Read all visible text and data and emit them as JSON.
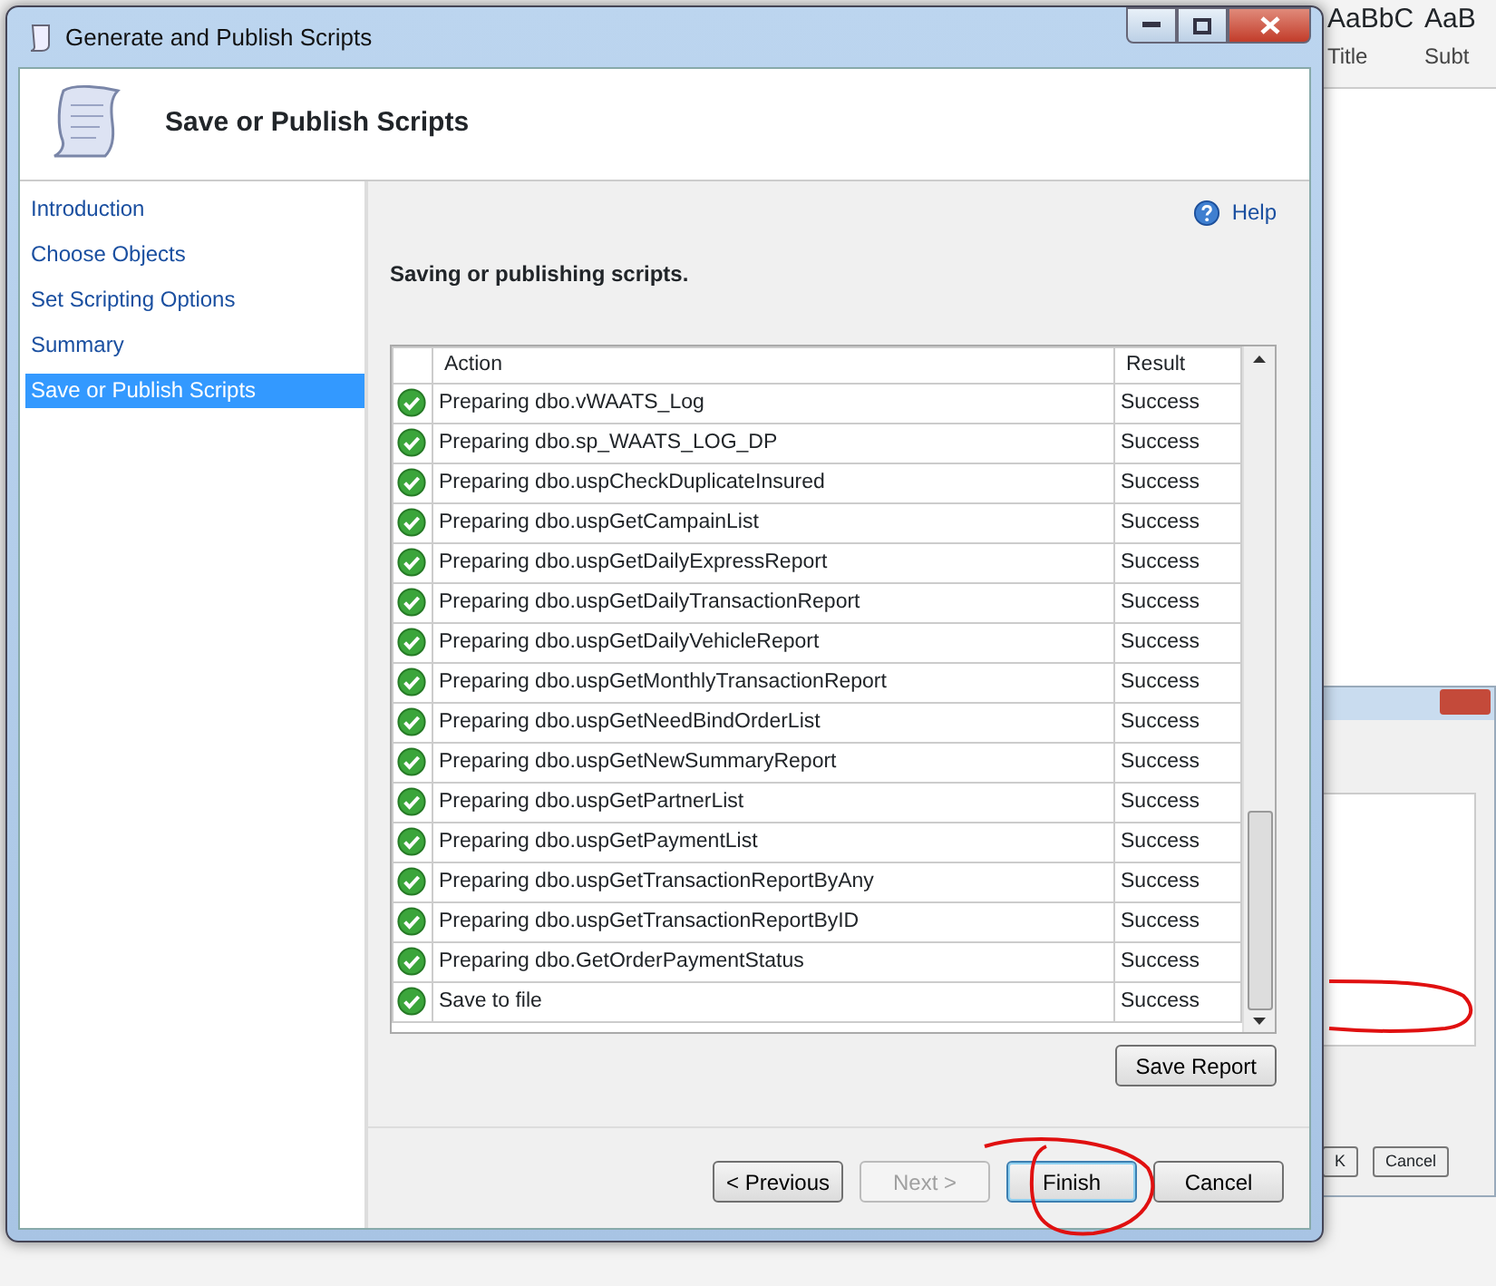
{
  "window": {
    "title": "Generate and Publish Scripts"
  },
  "header": {
    "title": "Save or Publish Scripts"
  },
  "nav": [
    {
      "label": "Introduction",
      "selected": false
    },
    {
      "label": "Choose Objects",
      "selected": false
    },
    {
      "label": "Set Scripting Options",
      "selected": false
    },
    {
      "label": "Summary",
      "selected": false
    },
    {
      "label": "Save or Publish Scripts",
      "selected": true
    }
  ],
  "help": "Help",
  "heading": "Saving or publishing scripts.",
  "table": {
    "columns": [
      "Action",
      "Result"
    ],
    "rows": [
      {
        "kind": "success",
        "action": "Preparing dbo.vWAATS_Log",
        "result": "Success"
      },
      {
        "kind": "success",
        "action": "Preparing dbo.sp_WAATS_LOG_DP",
        "result": "Success"
      },
      {
        "kind": "success",
        "action": "Preparing dbo.uspCheckDuplicateInsured",
        "result": "Success"
      },
      {
        "kind": "success",
        "action": "Preparing dbo.uspGetCampainList",
        "result": "Success"
      },
      {
        "kind": "success",
        "action": "Preparing dbo.uspGetDailyExpressReport",
        "result": "Success"
      },
      {
        "kind": "success",
        "action": "Preparing dbo.uspGetDailyTransactionReport",
        "result": "Success"
      },
      {
        "kind": "success",
        "action": "Preparing dbo.uspGetDailyVehicleReport",
        "result": "Success"
      },
      {
        "kind": "success",
        "action": "Preparing dbo.uspGetMonthlyTransactionReport",
        "result": "Success"
      },
      {
        "kind": "success",
        "action": "Preparing dbo.uspGetNeedBindOrderList",
        "result": "Success"
      },
      {
        "kind": "success",
        "action": "Preparing dbo.uspGetNewSummaryReport",
        "result": "Success"
      },
      {
        "kind": "success",
        "action": "Preparing dbo.uspGetPartnerList",
        "result": "Success"
      },
      {
        "kind": "success",
        "action": "Preparing dbo.uspGetPaymentList",
        "result": "Success"
      },
      {
        "kind": "success",
        "action": "Preparing dbo.uspGetTransactionReportByAny",
        "result": "Success"
      },
      {
        "kind": "success",
        "action": "Preparing dbo.uspGetTransactionReportByID",
        "result": "Success"
      },
      {
        "kind": "success",
        "action": "Preparing dbo.GetOrderPaymentStatus",
        "result": "Success"
      },
      {
        "kind": "success",
        "action": "Save to file",
        "result": "Success"
      }
    ]
  },
  "save_report": "Save Report",
  "buttons": [
    {
      "label": "< Previous",
      "disabled": false,
      "default": false
    },
    {
      "label": "Next >",
      "disabled": true,
      "default": false
    },
    {
      "label": "Finish",
      "disabled": false,
      "default": true
    },
    {
      "label": "Cancel",
      "disabled": false,
      "default": false
    }
  ],
  "background": {
    "styles": [
      {
        "sample": "AaBbC",
        "name": "Title"
      },
      {
        "sample": "AaB",
        "name": "Subt"
      }
    ],
    "dialog_buttons": [
      "K",
      "Cancel"
    ]
  }
}
